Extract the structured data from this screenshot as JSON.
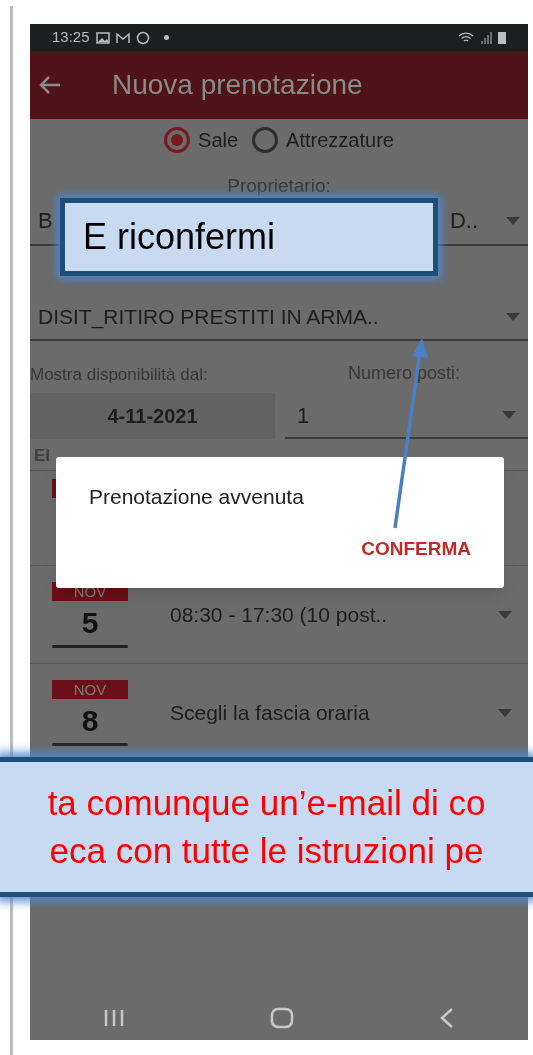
{
  "status_bar": {
    "time": "13:25"
  },
  "app_bar": {
    "title": "Nuova prenotazione"
  },
  "type_options": [
    {
      "label": "Sale",
      "selected": true
    },
    {
      "label": "Attrezzature",
      "selected": false
    }
  ],
  "owner": {
    "label": "Proprietario:",
    "value_start": "B",
    "value_end": "D.."
  },
  "resource": {
    "value": "DISIT_RITIRO PRESTITI IN ARMA.."
  },
  "date_field": {
    "label": "Mostra disponibilità dal:",
    "value": "4-11-2021"
  },
  "seats_field": {
    "label": "Numero posti:",
    "value": "1"
  },
  "list_header": "El",
  "days": [
    {
      "month": "NOV",
      "day": "5",
      "slot": "08:30 - 17:30 (10 post.."
    },
    {
      "month": "NOV",
      "day": "8",
      "slot": "Scegli la fascia oraria"
    }
  ],
  "dialog": {
    "message": "Prenotazione avvenuta",
    "button": "CONFERMA"
  },
  "callouts": [
    {
      "kind": "box",
      "lines": [
        "E riconfermi"
      ]
    },
    {
      "kind": "banner",
      "lines": [
        "ta comunque un’e-mail di co",
        "eca con tutte le istruzioni pe"
      ]
    }
  ]
}
